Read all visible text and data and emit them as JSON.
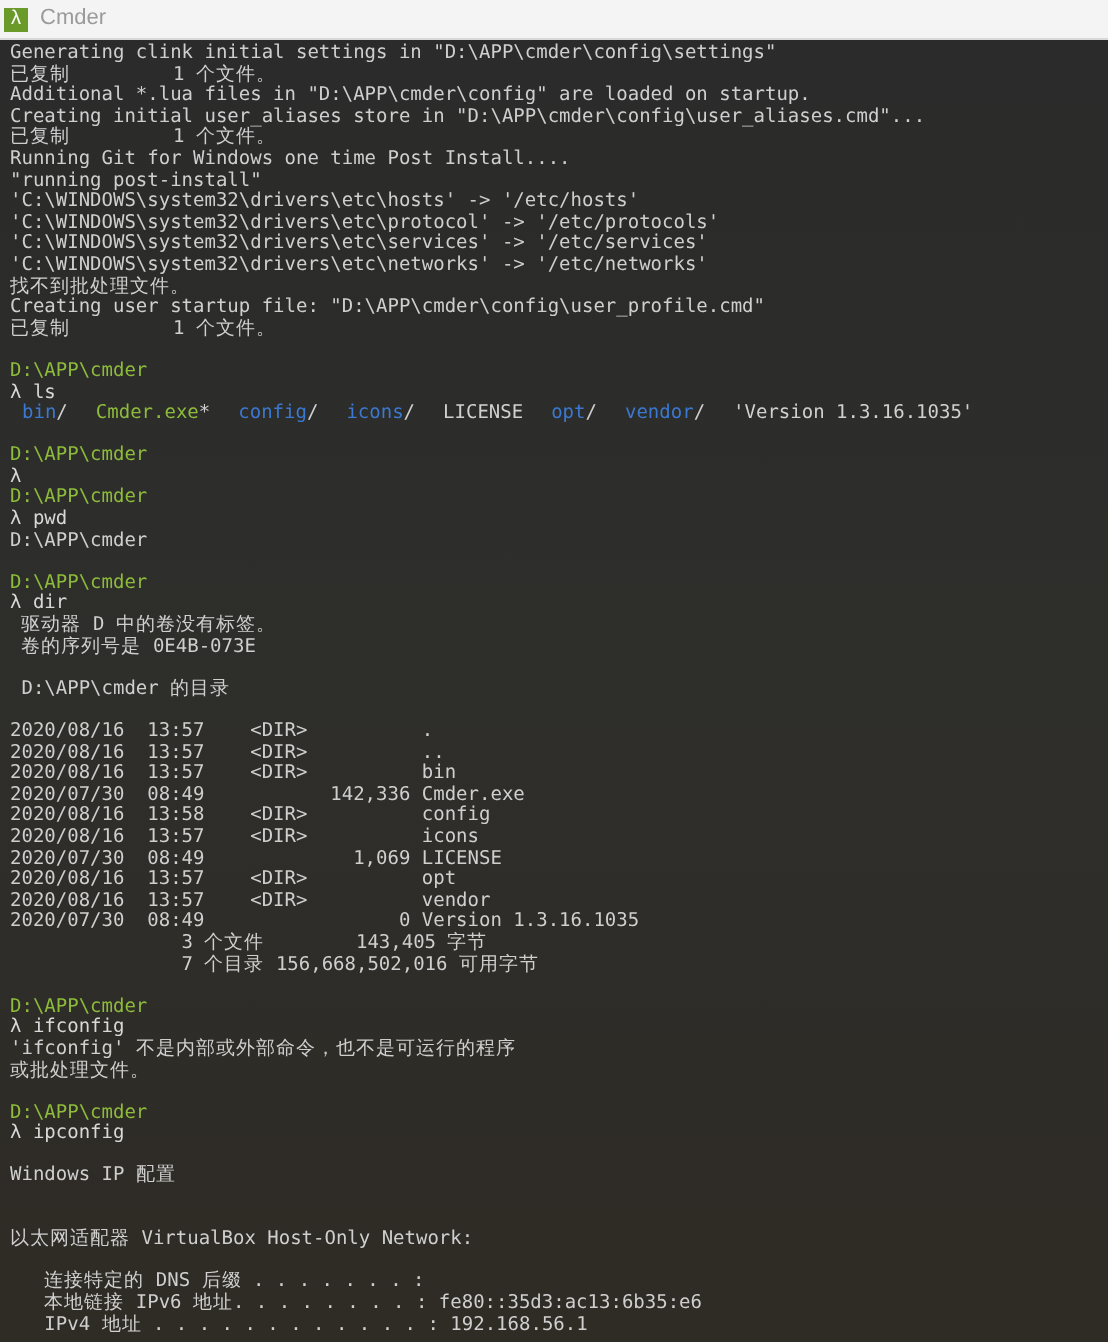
{
  "window": {
    "icon": "λ",
    "title": "Cmder"
  },
  "lines": [
    {
      "kind": "output",
      "text": "Generating clink initial settings in \"D:\\APP\\cmder\\config\\settings\""
    },
    {
      "kind": "output",
      "text": "已复制         1 个文件。"
    },
    {
      "kind": "output",
      "text": "Additional *.lua files in \"D:\\APP\\cmder\\config\" are loaded on startup."
    },
    {
      "kind": "output",
      "text": "Creating initial user_aliases store in \"D:\\APP\\cmder\\config\\user_aliases.cmd\"..."
    },
    {
      "kind": "output",
      "text": "已复制         1 个文件。"
    },
    {
      "kind": "output",
      "text": "Running Git for Windows one time Post Install...."
    },
    {
      "kind": "output",
      "text": "\"running post-install\""
    },
    {
      "kind": "output",
      "text": "'C:\\WINDOWS\\system32\\drivers\\etc\\hosts' -> '/etc/hosts'"
    },
    {
      "kind": "output",
      "text": "'C:\\WINDOWS\\system32\\drivers\\etc\\protocol' -> '/etc/protocols'"
    },
    {
      "kind": "output",
      "text": "'C:\\WINDOWS\\system32\\drivers\\etc\\services' -> '/etc/services'"
    },
    {
      "kind": "output",
      "text": "'C:\\WINDOWS\\system32\\drivers\\etc\\networks' -> '/etc/networks'"
    },
    {
      "kind": "output",
      "text": "找不到批处理文件。"
    },
    {
      "kind": "output",
      "text": "Creating user startup file: \"D:\\APP\\cmder\\config\\user_profile.cmd\""
    },
    {
      "kind": "output",
      "text": "已复制         1 个文件。"
    },
    {
      "kind": "blank"
    },
    {
      "kind": "prompt",
      "text": "D:\\APP\\cmder"
    },
    {
      "kind": "command",
      "text": "λ ls"
    },
    {
      "kind": "listing",
      "items": [
        {
          "kind": "dir",
          "name": "bin",
          "suffix": "/"
        },
        {
          "kind": "exe",
          "name": "Cmder.exe",
          "suffix": "*"
        },
        {
          "kind": "dir",
          "name": "config",
          "suffix": "/"
        },
        {
          "kind": "dir",
          "name": "icons",
          "suffix": "/"
        },
        {
          "kind": "file",
          "name": "LICENSE"
        },
        {
          "kind": "dir",
          "name": "opt",
          "suffix": "/"
        },
        {
          "kind": "dir",
          "name": "vendor",
          "suffix": "/"
        },
        {
          "kind": "file",
          "name": "'Version 1.3.16.1035'"
        }
      ]
    },
    {
      "kind": "blank"
    },
    {
      "kind": "prompt",
      "text": "D:\\APP\\cmder"
    },
    {
      "kind": "command",
      "text": "λ"
    },
    {
      "kind": "prompt",
      "text": "D:\\APP\\cmder"
    },
    {
      "kind": "command",
      "text": "λ pwd"
    },
    {
      "kind": "output",
      "text": "D:\\APP\\cmder"
    },
    {
      "kind": "blank"
    },
    {
      "kind": "prompt",
      "text": "D:\\APP\\cmder"
    },
    {
      "kind": "command",
      "text": "λ dir"
    },
    {
      "kind": "output",
      "text": " 驱动器 D 中的卷没有标签。"
    },
    {
      "kind": "output",
      "text": " 卷的序列号是 0E4B-073E"
    },
    {
      "kind": "blank"
    },
    {
      "kind": "output",
      "text": " D:\\APP\\cmder 的目录"
    },
    {
      "kind": "blank"
    },
    {
      "kind": "output",
      "text": "2020/08/16  13:57    <DIR>          ."
    },
    {
      "kind": "output",
      "text": "2020/08/16  13:57    <DIR>          .."
    },
    {
      "kind": "output",
      "text": "2020/08/16  13:57    <DIR>          bin"
    },
    {
      "kind": "output",
      "text": "2020/07/30  08:49           142,336 Cmder.exe"
    },
    {
      "kind": "output",
      "text": "2020/08/16  13:58    <DIR>          config"
    },
    {
      "kind": "output",
      "text": "2020/08/16  13:57    <DIR>          icons"
    },
    {
      "kind": "output",
      "text": "2020/07/30  08:49             1,069 LICENSE"
    },
    {
      "kind": "output",
      "text": "2020/08/16  13:57    <DIR>          opt"
    },
    {
      "kind": "output",
      "text": "2020/08/16  13:57    <DIR>          vendor"
    },
    {
      "kind": "output",
      "text": "2020/07/30  08:49                 0 Version 1.3.16.1035"
    },
    {
      "kind": "output",
      "text": "               3 个文件        143,405 字节"
    },
    {
      "kind": "output",
      "text": "               7 个目录 156,668,502,016 可用字节"
    },
    {
      "kind": "blank"
    },
    {
      "kind": "prompt",
      "text": "D:\\APP\\cmder"
    },
    {
      "kind": "command",
      "text": "λ ifconfig"
    },
    {
      "kind": "output",
      "text": "'ifconfig' 不是内部或外部命令，也不是可运行的程序"
    },
    {
      "kind": "output",
      "text": "或批处理文件。"
    },
    {
      "kind": "blank"
    },
    {
      "kind": "prompt",
      "text": "D:\\APP\\cmder"
    },
    {
      "kind": "command",
      "text": "λ ipconfig"
    },
    {
      "kind": "blank"
    },
    {
      "kind": "output",
      "text": "Windows IP 配置"
    },
    {
      "kind": "blank"
    },
    {
      "kind": "blank"
    },
    {
      "kind": "output",
      "text": "以太网适配器 VirtualBox Host-Only Network:"
    },
    {
      "kind": "blank"
    },
    {
      "kind": "output",
      "text": "   连接特定的 DNS 后缀 . . . . . . . :"
    },
    {
      "kind": "output",
      "text": "   本地链接 IPv6 地址. . . . . . . . : fe80::35d3:ac13:6b35:e6"
    },
    {
      "kind": "output",
      "text": "   IPv4 地址 . . . . . . . . . . . . : 192.168.56.1"
    }
  ]
}
